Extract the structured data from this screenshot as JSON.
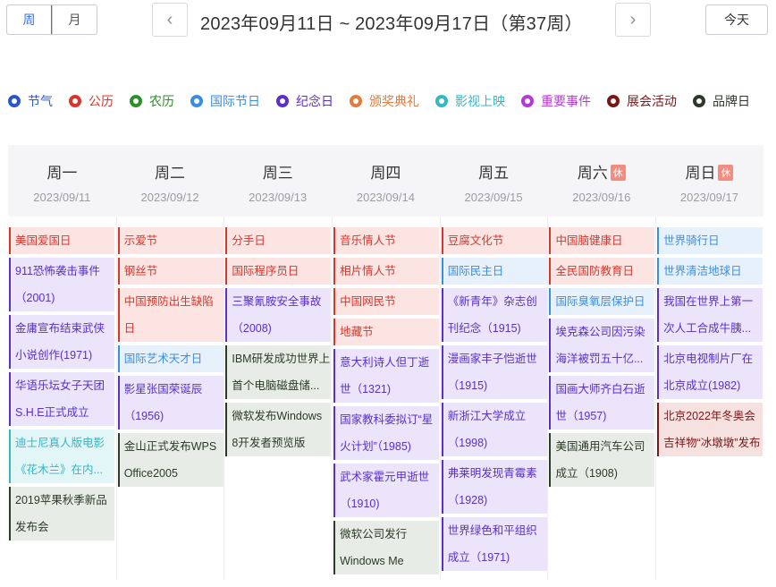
{
  "toolbar": {
    "week_label": "周",
    "month_label": "月",
    "prev_glyph": "‹",
    "next_glyph": "›",
    "date_range": "2023年09月11日 ~ 2023年09月17日（第37周）",
    "today_label": "今天"
  },
  "legend": [
    {
      "label": "节气",
      "color": "#2a57c9"
    },
    {
      "label": "公历",
      "color": "#d9352b"
    },
    {
      "label": "农历",
      "color": "#2f8f2c"
    },
    {
      "label": "国际节日",
      "color": "#3b8de0"
    },
    {
      "label": "纪念日",
      "color": "#5a2fcb"
    },
    {
      "label": "颁奖典礼",
      "color": "#e47a3b"
    },
    {
      "label": "影视上映",
      "color": "#37b6c7"
    },
    {
      "label": "重要事件",
      "color": "#b53ad3"
    },
    {
      "label": "展会活动",
      "color": "#7a1717"
    },
    {
      "label": "品牌日",
      "color": "#2d3a29"
    }
  ],
  "rest_badge": "休",
  "days": [
    {
      "name": "周一",
      "date": "2023/09/11",
      "rest": false,
      "events": [
        {
          "text": "美国爱国日",
          "cat": "gongli",
          "lines": 1
        },
        {
          "text": "911恐怖袭击事件（2001)",
          "cat": "jinian",
          "lines": 2
        },
        {
          "text": "金庸宣布结束武侠小说创作(1971)",
          "cat": "jinian",
          "lines": 2
        },
        {
          "text": "华语乐坛女子天团S.H.E正式成立",
          "cat": "jinian",
          "lines": 2
        },
        {
          "text": "迪士尼真人版电影《花木兰》在内...",
          "cat": "yingshi",
          "lines": 2
        },
        {
          "text": "2019苹果秋季新品发布会",
          "cat": "pinpai",
          "lines": 2
        }
      ]
    },
    {
      "name": "周二",
      "date": "2023/09/12",
      "rest": false,
      "events": [
        {
          "text": "示爱节",
          "cat": "gongli",
          "lines": 1
        },
        {
          "text": "钢丝节",
          "cat": "gongli",
          "lines": 1
        },
        {
          "text": "中国预防出生缺陷日",
          "cat": "gongli",
          "lines": 2
        },
        {
          "text": "国际艺术天才日",
          "cat": "guoji",
          "lines": 1
        },
        {
          "text": "影星张国荣诞辰（1956)",
          "cat": "jinian",
          "lines": 2
        },
        {
          "text": "金山正式发布WPS Office2005",
          "cat": "pinpai",
          "lines": 2
        }
      ]
    },
    {
      "name": "周三",
      "date": "2023/09/13",
      "rest": false,
      "events": [
        {
          "text": "分手日",
          "cat": "gongli",
          "lines": 1
        },
        {
          "text": "国际程序员日",
          "cat": "gongli",
          "lines": 1
        },
        {
          "text": "三聚氰胺安全事故（2008)",
          "cat": "jinian",
          "lines": 2
        },
        {
          "text": "IBM研发成功世界上首个电脑磁盘储...",
          "cat": "pinpai",
          "lines": 2
        },
        {
          "text": "微软发布Windows 8开发者预览版",
          "cat": "pinpai",
          "lines": 2
        }
      ]
    },
    {
      "name": "周四",
      "date": "2023/09/14",
      "rest": false,
      "events": [
        {
          "text": "音乐情人节",
          "cat": "gongli",
          "lines": 1
        },
        {
          "text": "相片情人节",
          "cat": "gongli",
          "lines": 1
        },
        {
          "text": "中国网民节",
          "cat": "gongli",
          "lines": 1
        },
        {
          "text": "地藏节",
          "cat": "gongli",
          "lines": 1
        },
        {
          "text": "意大利诗人但丁逝世（1321)",
          "cat": "jinian",
          "lines": 2
        },
        {
          "text": "国家教科委拟订“星火计划”（1985)",
          "cat": "jinian",
          "lines": 2
        },
        {
          "text": "武术家霍元甲逝世（1910)",
          "cat": "jinian",
          "lines": 2
        },
        {
          "text": "微软公司发行Windows Me",
          "cat": "pinpai",
          "lines": 2
        }
      ]
    },
    {
      "name": "周五",
      "date": "2023/09/15",
      "rest": false,
      "events": [
        {
          "text": "豆腐文化节",
          "cat": "gongli",
          "lines": 1
        },
        {
          "text": "国际民主日",
          "cat": "guoji",
          "lines": 1
        },
        {
          "text": "《新青年》杂志创刊纪念（1915)",
          "cat": "jinian",
          "lines": 2
        },
        {
          "text": "漫画家丰子恺逝世（1915)",
          "cat": "jinian",
          "lines": 2
        },
        {
          "text": "新浙江大学成立（1998)",
          "cat": "jinian",
          "lines": 2
        },
        {
          "text": "弗莱明发现青霉素（1928)",
          "cat": "jinian",
          "lines": 2
        },
        {
          "text": "世界绿色和平组织成立（1971)",
          "cat": "jinian",
          "lines": 2
        }
      ]
    },
    {
      "name": "周六",
      "date": "2023/09/16",
      "rest": true,
      "events": [
        {
          "text": "中国脑健康日",
          "cat": "gongli",
          "lines": 1
        },
        {
          "text": "全民国防教育日",
          "cat": "gongli",
          "lines": 1
        },
        {
          "text": "国际臭氧层保护日",
          "cat": "guoji",
          "lines": 1
        },
        {
          "text": "埃克森公司因污染海洋被罚五十亿...",
          "cat": "jinian",
          "lines": 2
        },
        {
          "text": "国画大师齐白石逝世（1957)",
          "cat": "jinian",
          "lines": 2
        },
        {
          "text": "美国通用汽车公司成立（1908)",
          "cat": "pinpai",
          "lines": 2
        }
      ]
    },
    {
      "name": "周日",
      "date": "2023/09/17",
      "rest": true,
      "events": [
        {
          "text": "世界骑行日",
          "cat": "guoji",
          "lines": 1
        },
        {
          "text": "世界清洁地球日",
          "cat": "guoji",
          "lines": 1
        },
        {
          "text": "我国在世界上第一次人工合成牛胰...",
          "cat": "jinian",
          "lines": 2
        },
        {
          "text": "北京电视制片厂在北京成立(1982)",
          "cat": "jinian",
          "lines": 2
        },
        {
          "text": "北京2022年冬奥会吉祥物“冰墩墩”发布",
          "cat": "zhanhui",
          "lines": 2
        }
      ]
    }
  ]
}
